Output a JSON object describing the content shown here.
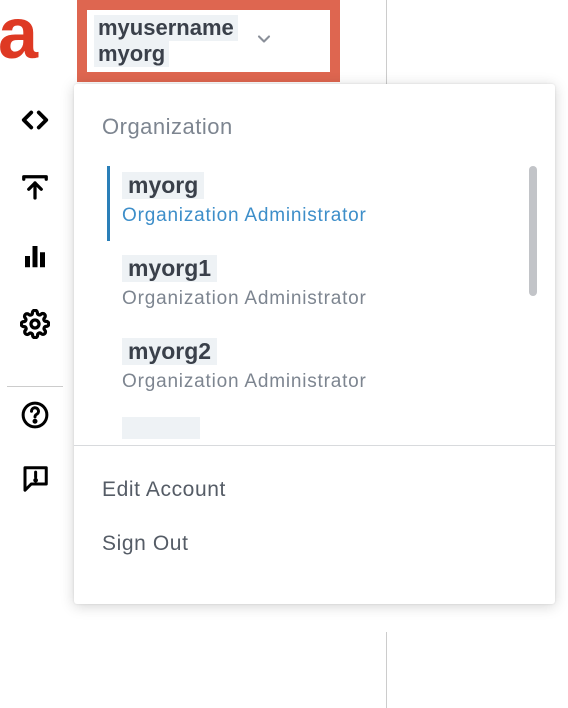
{
  "header": {
    "username": "myusername",
    "org": "myorg"
  },
  "dropdown": {
    "section_label": "Organization",
    "orgs": [
      {
        "name": "myorg",
        "role": "Organization Administrator",
        "selected": true
      },
      {
        "name": "myorg1",
        "role": "Organization Administrator",
        "selected": false
      },
      {
        "name": "myorg2",
        "role": "Organization Administrator",
        "selected": false
      }
    ],
    "actions": {
      "edit_account": "Edit Account",
      "sign_out": "Sign Out"
    }
  }
}
